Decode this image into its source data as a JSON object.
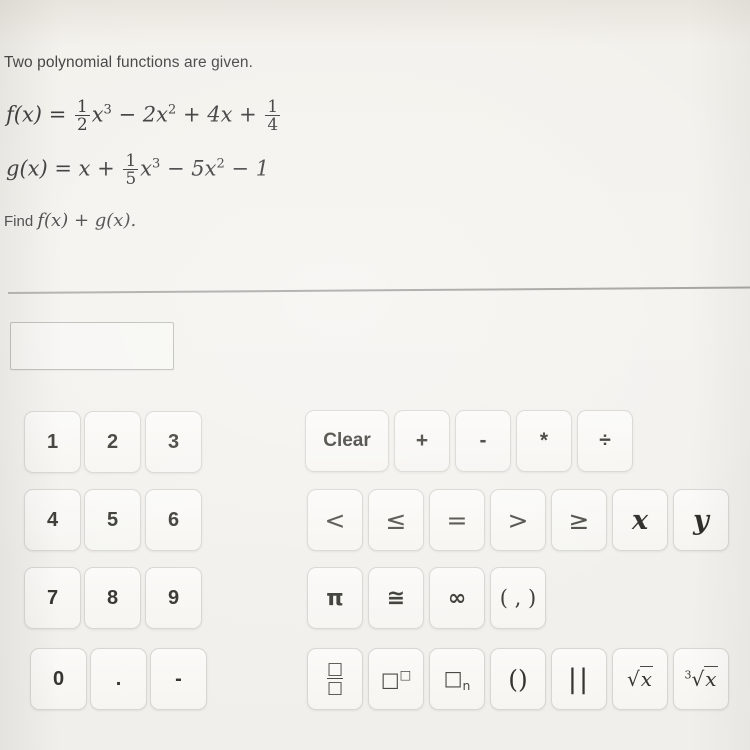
{
  "problem": {
    "prompt": "Two polynomial functions are given.",
    "function_f": {
      "name": "f(x)",
      "equals": "=",
      "coeff_frac_num": "1",
      "coeff_frac_den": "2",
      "term1_var": "x",
      "term1_power": "3",
      "term2": "− 2x",
      "term2_power": "2",
      "term3": "+ 4x +",
      "const_frac_num": "1",
      "const_frac_den": "4",
      "plain": "f(x) = 1/2 x^3 − 2x^2 + 4x + 1/4"
    },
    "function_g": {
      "name": "g(x)",
      "equals": "=",
      "lead": "x +",
      "coeff_frac_num": "1",
      "coeff_frac_den": "5",
      "term1_var": "x",
      "term1_power": "3",
      "term2": "− 5x",
      "term2_power": "2",
      "term3": "− 1",
      "plain": "g(x) = x + 1/5 x^3 − 5x^2 − 1"
    },
    "instruction_prefix": "Find",
    "instruction_math": "f(x) + g(x).",
    "instruction_plain": "Find f(x) + g(x)."
  },
  "answer": {
    "value": "",
    "placeholder": ""
  },
  "keypad": {
    "numbers": [
      {
        "label": "1",
        "name": "key-1"
      },
      {
        "label": "2",
        "name": "key-2"
      },
      {
        "label": "3",
        "name": "key-3"
      },
      {
        "label": "4",
        "name": "key-4"
      },
      {
        "label": "5",
        "name": "key-5"
      },
      {
        "label": "6",
        "name": "key-6"
      },
      {
        "label": "7",
        "name": "key-7"
      },
      {
        "label": "8",
        "name": "key-8"
      },
      {
        "label": "9",
        "name": "key-9"
      },
      {
        "label": "0",
        "name": "key-0"
      },
      {
        "label": ".",
        "name": "key-decimal-point"
      },
      {
        "label": "-",
        "name": "key-minus-sign"
      }
    ],
    "row_operators": [
      {
        "label": "Clear",
        "name": "key-clear"
      },
      {
        "label": "+",
        "name": "key-plus"
      },
      {
        "label": "-",
        "name": "key-subtract"
      },
      {
        "label": "*",
        "name": "key-multiply"
      },
      {
        "label": "÷",
        "name": "key-divide"
      }
    ],
    "row_relations": [
      {
        "label": "<",
        "name": "key-less-than"
      },
      {
        "label": "≤",
        "name": "key-less-than-or-equal"
      },
      {
        "label": "=",
        "name": "key-equals"
      },
      {
        "label": ">",
        "name": "key-greater-than"
      },
      {
        "label": "≥",
        "name": "key-greater-than-or-equal"
      },
      {
        "label": "x",
        "name": "key-variable-x"
      },
      {
        "label": "y",
        "name": "key-variable-y"
      }
    ],
    "row_symbols": [
      {
        "label": "π",
        "name": "key-pi"
      },
      {
        "label": "≅",
        "name": "key-congruent"
      },
      {
        "label": "∞",
        "name": "key-infinity"
      },
      {
        "label": "( , )",
        "name": "key-ordered-pair"
      }
    ],
    "row_templates": [
      {
        "label": "□/□",
        "name": "key-fraction-template"
      },
      {
        "label": "□^□",
        "name": "key-exponent-template"
      },
      {
        "label": "□n",
        "name": "key-subscript-template"
      },
      {
        "label": "()",
        "name": "key-parentheses"
      },
      {
        "label": "||",
        "name": "key-absolute-value"
      },
      {
        "label": "√x",
        "name": "key-square-root"
      },
      {
        "label": "∛x",
        "name": "key-nth-root"
      }
    ],
    "template_glyphs": {
      "frac_num": "□",
      "frac_den": "□",
      "sup_base": "□",
      "sup_exp": "□",
      "sub_base": "□",
      "sub_index": "n",
      "paren": "()",
      "abs": "||",
      "root_radical": "√",
      "root_var": "x",
      "nth_index": "3"
    }
  },
  "colors": {
    "page_background": "#f2f1ed",
    "button_face": "#f8f7f4",
    "button_border": "#d7d6d1",
    "text": "#35352f",
    "divider": "#8d8d8a",
    "answer_box_border": "#b9b9b4"
  }
}
